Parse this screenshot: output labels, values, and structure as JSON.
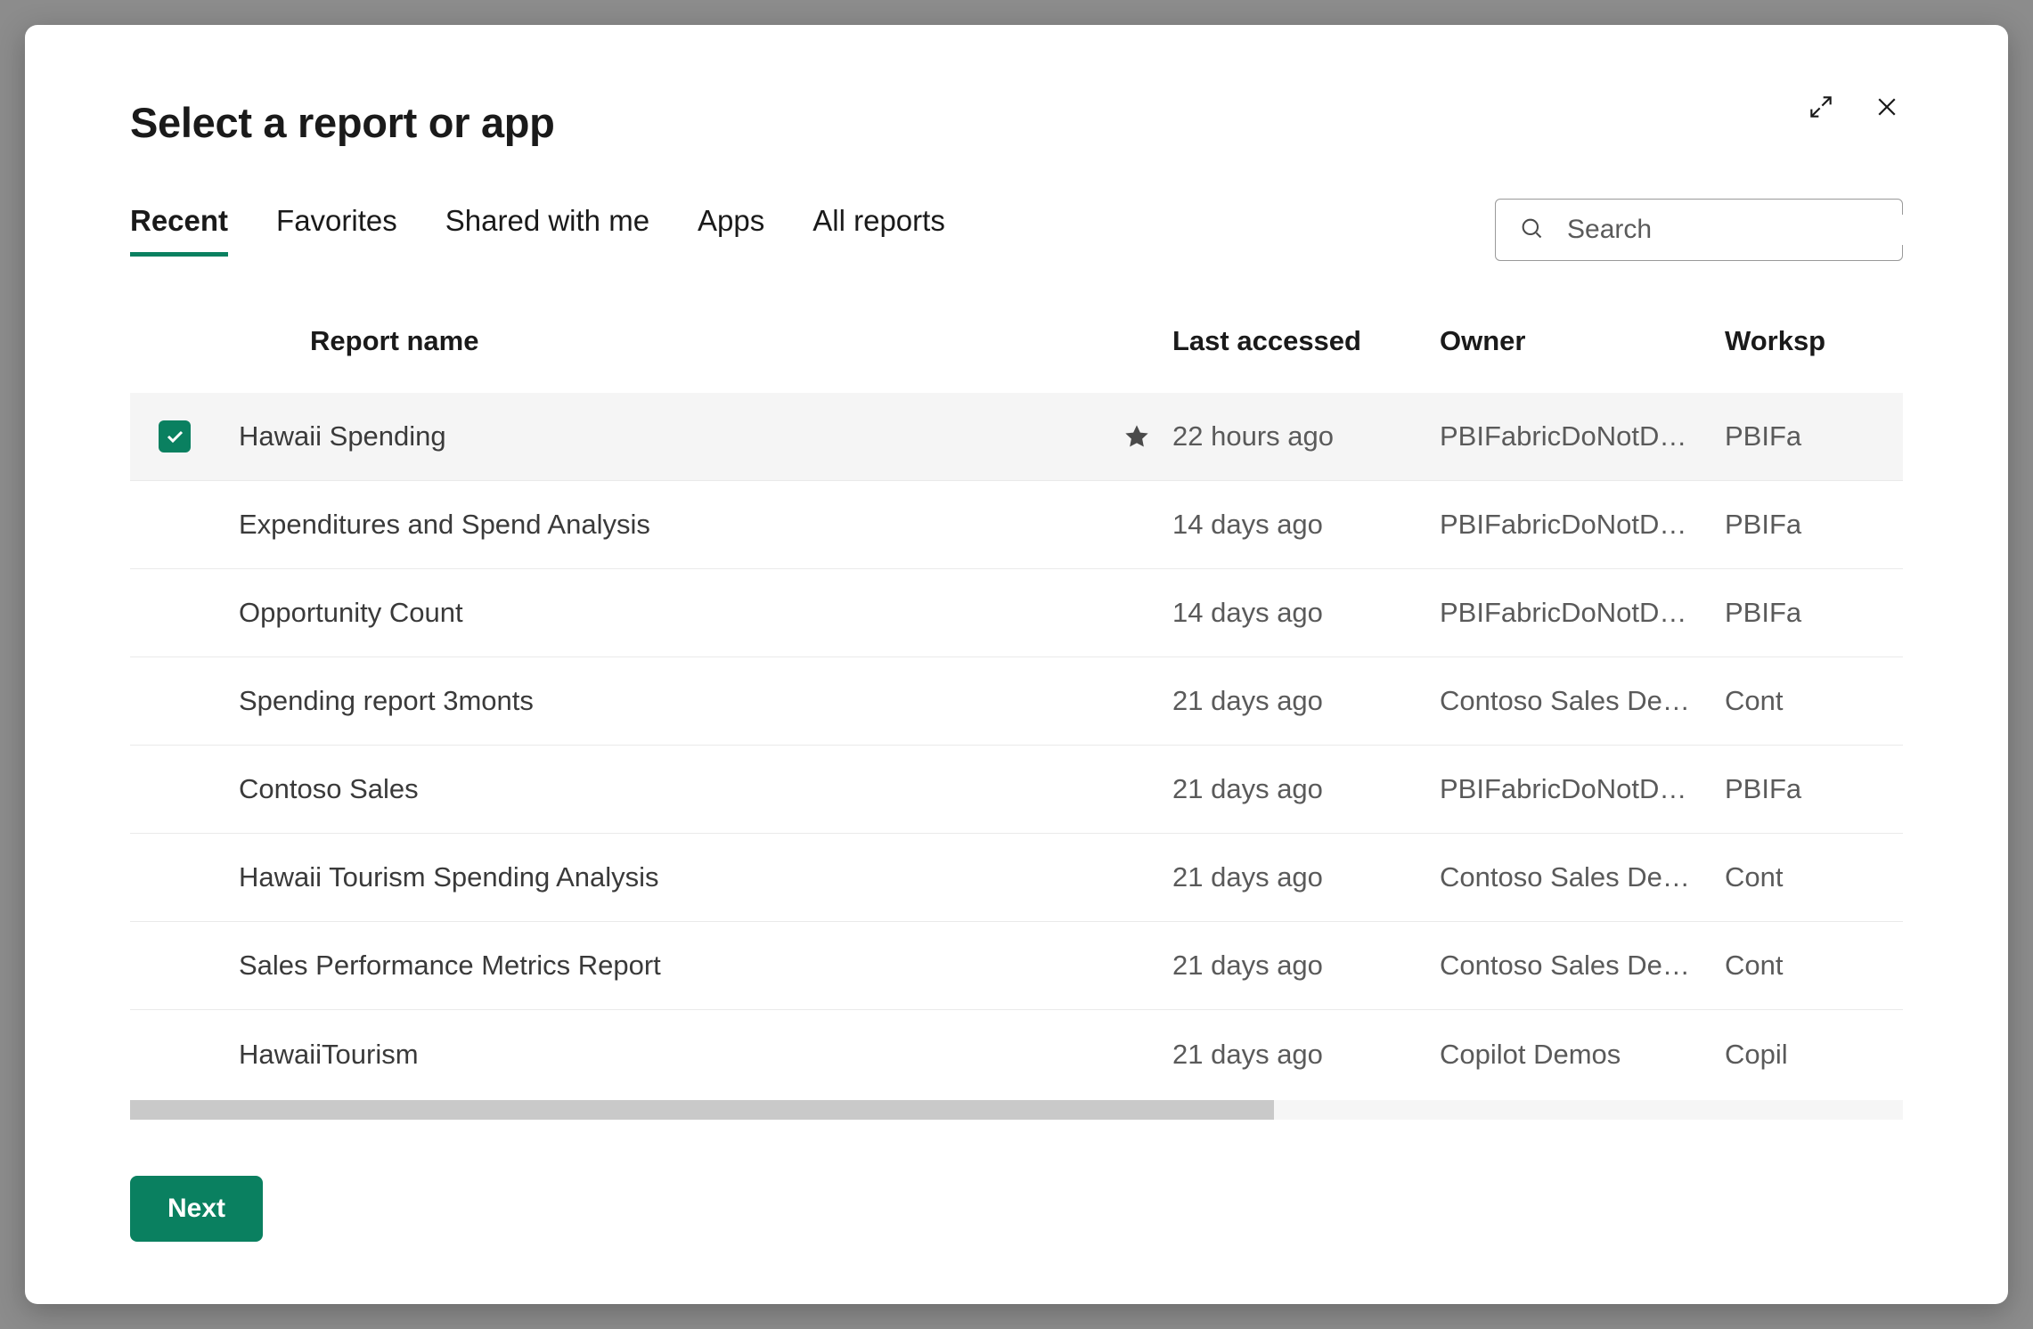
{
  "dialog": {
    "title": "Select a report or app",
    "tabs": [
      "Recent",
      "Favorites",
      "Shared with me",
      "Apps",
      "All reports"
    ],
    "active_tab": 0,
    "search_placeholder": "Search",
    "columns": {
      "name": "Report name",
      "last": "Last accessed",
      "owner": "Owner",
      "workspace": "Worksp"
    },
    "rows": [
      {
        "selected": true,
        "favorite": true,
        "name": "Hawaii Spending",
        "last": "22 hours ago",
        "owner": "PBIFabricDoNotD…",
        "workspace": "PBIFa"
      },
      {
        "selected": false,
        "favorite": false,
        "name": "Expenditures and Spend Analysis",
        "last": "14 days ago",
        "owner": "PBIFabricDoNotD…",
        "workspace": "PBIFa"
      },
      {
        "selected": false,
        "favorite": false,
        "name": "Opportunity Count",
        "last": "14 days ago",
        "owner": "PBIFabricDoNotD…",
        "workspace": "PBIFa"
      },
      {
        "selected": false,
        "favorite": false,
        "name": "Spending report 3monts",
        "last": "21 days ago",
        "owner": "Contoso Sales De…",
        "workspace": "Cont"
      },
      {
        "selected": false,
        "favorite": false,
        "name": "Contoso Sales",
        "last": "21 days ago",
        "owner": "PBIFabricDoNotD…",
        "workspace": "PBIFa"
      },
      {
        "selected": false,
        "favorite": false,
        "name": "Hawaii Tourism Spending Analysis",
        "last": "21 days ago",
        "owner": "Contoso Sales De…",
        "workspace": "Cont"
      },
      {
        "selected": false,
        "favorite": false,
        "name": "Sales Performance Metrics Report",
        "last": "21 days ago",
        "owner": "Contoso Sales De…",
        "workspace": "Cont"
      },
      {
        "selected": false,
        "favorite": false,
        "name": "HawaiiTourism",
        "last": "21 days ago",
        "owner": "Copilot Demos",
        "workspace": "Copil"
      }
    ],
    "next_label": "Next"
  }
}
